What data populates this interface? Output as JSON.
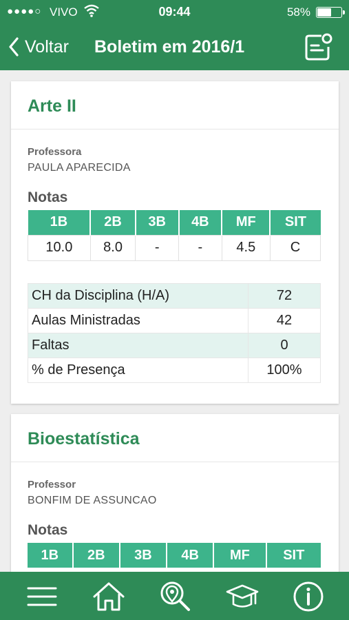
{
  "status_bar": {
    "signal": "●●●●○",
    "carrier": "VIVO",
    "time": "09:44",
    "battery_percent": "58%",
    "battery_level": 0.58
  },
  "nav": {
    "back_label": "Voltar",
    "title": "Boletim em 2016/1",
    "action_icon": "report-card-icon"
  },
  "colors": {
    "primary": "#2e8b57",
    "table_header": "#3db48b",
    "stripe": "#e3f3ef"
  },
  "subjects": [
    {
      "name": "Arte II",
      "teacher_role": "Professora",
      "teacher_name": "PAULA APARECIDA",
      "notas_label": "Notas",
      "grade_headers": [
        "1B",
        "2B",
        "3B",
        "4B",
        "MF",
        "SIT"
      ],
      "grades": [
        "10.0",
        "8.0",
        "-",
        "-",
        "4.5",
        "C"
      ],
      "stats": [
        {
          "label": "CH da Disciplina (H/A)",
          "value": "72"
        },
        {
          "label": "Aulas Ministradas",
          "value": "42"
        },
        {
          "label": "Faltas",
          "value": "0"
        },
        {
          "label": "% de Presença",
          "value": "100%"
        }
      ]
    },
    {
      "name": "Bioestatística",
      "teacher_role": "Professor",
      "teacher_name": "BONFIM DE ASSUNCAO",
      "notas_label": "Notas",
      "grade_headers": [
        "1B",
        "2B",
        "3B",
        "4B",
        "MF",
        "SIT"
      ]
    }
  ],
  "tabbar": {
    "items": [
      "menu-icon",
      "home-icon",
      "location-search-icon",
      "graduation-cap-icon",
      "info-icon"
    ]
  }
}
